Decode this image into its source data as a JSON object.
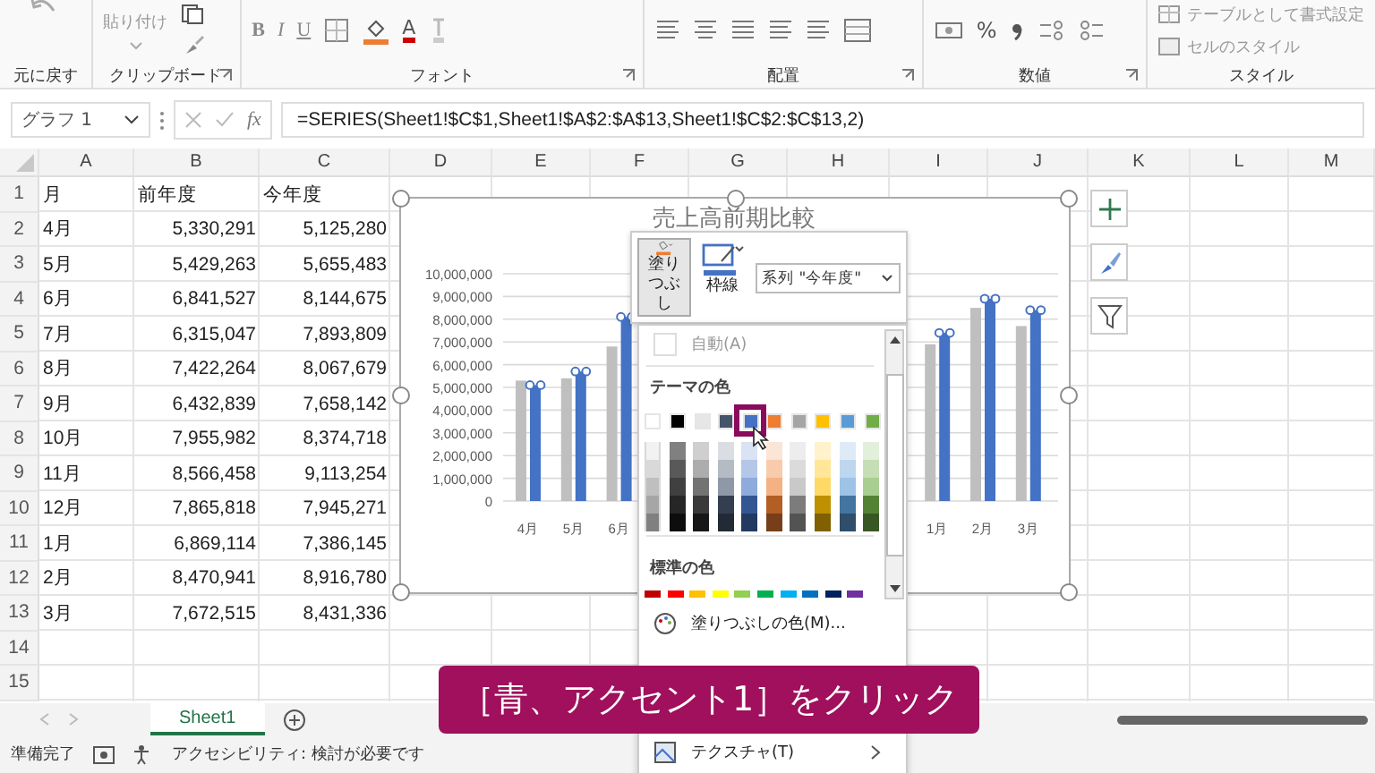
{
  "ribbon": {
    "groups": [
      {
        "kind": "undo",
        "label": "元に戻す",
        "launcher": false
      },
      {
        "kind": "clipboard",
        "label": "クリップボード",
        "launcher": true,
        "texts": [
          "貼り付け"
        ]
      },
      {
        "kind": "font",
        "label": "フォント",
        "launcher": true,
        "texts": [
          "B",
          "I",
          "U",
          "A"
        ]
      },
      {
        "kind": "align",
        "label": "配置",
        "launcher": true
      },
      {
        "kind": "number",
        "label": "数値",
        "launcher": true,
        "texts": [
          "%"
        ]
      },
      {
        "kind": "style",
        "label": "スタイル",
        "launcher": false,
        "texts": [
          "テーブルとして書式設定",
          "セルのスタイル"
        ]
      }
    ]
  },
  "formula_bar": {
    "name_box": "グラフ 1",
    "function_button": "fx",
    "formula": "=SERIES(Sheet1!$C$1,Sheet1!$A$2:$A$13,Sheet1!$C$2:$C$13,2)"
  },
  "sheet": {
    "columns": [
      "A",
      "B",
      "C",
      "D",
      "E",
      "F",
      "G",
      "H",
      "I",
      "J",
      "K",
      "L",
      "M"
    ],
    "row_numbers": [
      "1",
      "2",
      "3",
      "4",
      "5",
      "6",
      "7",
      "8",
      "9",
      "10",
      "11",
      "12",
      "13",
      "14",
      "15"
    ],
    "rows": [
      [
        "月",
        "前年度",
        "今年度"
      ],
      [
        "4月",
        "5,330,291",
        "5,125,280"
      ],
      [
        "5月",
        "5,429,263",
        "5,655,483"
      ],
      [
        "6月",
        "6,841,527",
        "8,144,675"
      ],
      [
        "7月",
        "6,315,047",
        "7,893,809"
      ],
      [
        "8月",
        "7,422,264",
        "8,067,679"
      ],
      [
        "9月",
        "6,432,839",
        "7,658,142"
      ],
      [
        "10月",
        "7,955,982",
        "8,374,718"
      ],
      [
        "11月",
        "8,566,458",
        "9,113,254"
      ],
      [
        "12月",
        "7,865,818",
        "7,945,271"
      ],
      [
        "1月",
        "6,869,114",
        "7,386,145"
      ],
      [
        "2月",
        "8,470,941",
        "8,916,780"
      ],
      [
        "3月",
        "7,672,515",
        "8,431,336"
      ]
    ]
  },
  "chart": {
    "chart_data": {
      "type": "bar",
      "title": "売上高前期比較",
      "categories": [
        "4月",
        "5月",
        "6月",
        null,
        null,
        null,
        null,
        null,
        null,
        "1月",
        "2月",
        "3月"
      ],
      "series": [
        {
          "color": "#bfbfbf",
          "values": [
            5300000,
            5400000,
            6800000,
            null,
            null,
            null,
            null,
            null,
            null,
            6900000,
            8500000,
            7700000
          ]
        },
        {
          "color": "#4472c4",
          "values": [
            5100000,
            5700000,
            8100000,
            null,
            null,
            null,
            null,
            null,
            null,
            7400000,
            8900000,
            8400000
          ]
        }
      ],
      "ylim": [
        0,
        10000000
      ],
      "grid": true,
      "yticks": [
        {
          "value": 0,
          "label": "0"
        },
        {
          "value": 1000000,
          "label": "1,000,000"
        },
        {
          "value": 2000000,
          "label": "2,000,000"
        },
        {
          "value": 3000000,
          "label": "3,000,000"
        },
        {
          "value": 4000000,
          "label": "4,000,000"
        },
        {
          "value": 5000000,
          "label": "5,000,000"
        },
        {
          "value": 6000000,
          "label": "6,000,000"
        },
        {
          "value": 7000000,
          "label": "7,000,000"
        },
        {
          "value": 8000000,
          "label": "8,000,000"
        },
        {
          "value": 9000000,
          "label": "9,000,000"
        },
        {
          "value": 10000000,
          "label": "10,000,000"
        }
      ]
    }
  },
  "format_toolbar": {
    "fill_button": {
      "label": "塗りつぶし",
      "selected": true
    },
    "outline_button": {
      "label": "枠線",
      "selected": false
    },
    "series_dropdown": "系列 \"今年度\""
  },
  "fill_menu": {
    "automatic": "自動(A)",
    "theme_heading": "テーマの色",
    "theme_colors": [
      {
        "color": "#ffffff",
        "selected": false
      },
      {
        "color": "#000000",
        "selected": false
      },
      {
        "color": "#e7e6e6",
        "selected": false
      },
      {
        "color": "#44546a",
        "selected": false
      },
      {
        "color": "#4472c4",
        "selected": true
      },
      {
        "color": "#ed7d31",
        "selected": false
      },
      {
        "color": "#a5a5a5",
        "selected": false
      },
      {
        "color": "#ffc000",
        "selected": false
      },
      {
        "color": "#5b9bd5",
        "selected": false
      },
      {
        "color": "#70ad47",
        "selected": false
      }
    ],
    "standard_heading": "標準の色",
    "standard_colors": [
      {
        "color": "#c00000"
      },
      {
        "color": "#ff0000"
      },
      {
        "color": "#ffc000"
      },
      {
        "color": "#ffff00"
      },
      {
        "color": "#92d050"
      },
      {
        "color": "#00b050"
      },
      {
        "color": "#00b0f0"
      },
      {
        "color": "#0070c0"
      },
      {
        "color": "#002060"
      },
      {
        "color": "#7030a0"
      }
    ],
    "more_colors": "塗りつぶしの色(M)...",
    "texture": "テクスチャ(T)"
  },
  "caption": "［青、アクセント1］をクリック",
  "sheet_tabs": [
    {
      "label": "Sheet1",
      "selected": true
    }
  ],
  "status_bar": {
    "ready": "準備完了",
    "accessibility": "アクセシビリティ: 検討が必要です"
  }
}
